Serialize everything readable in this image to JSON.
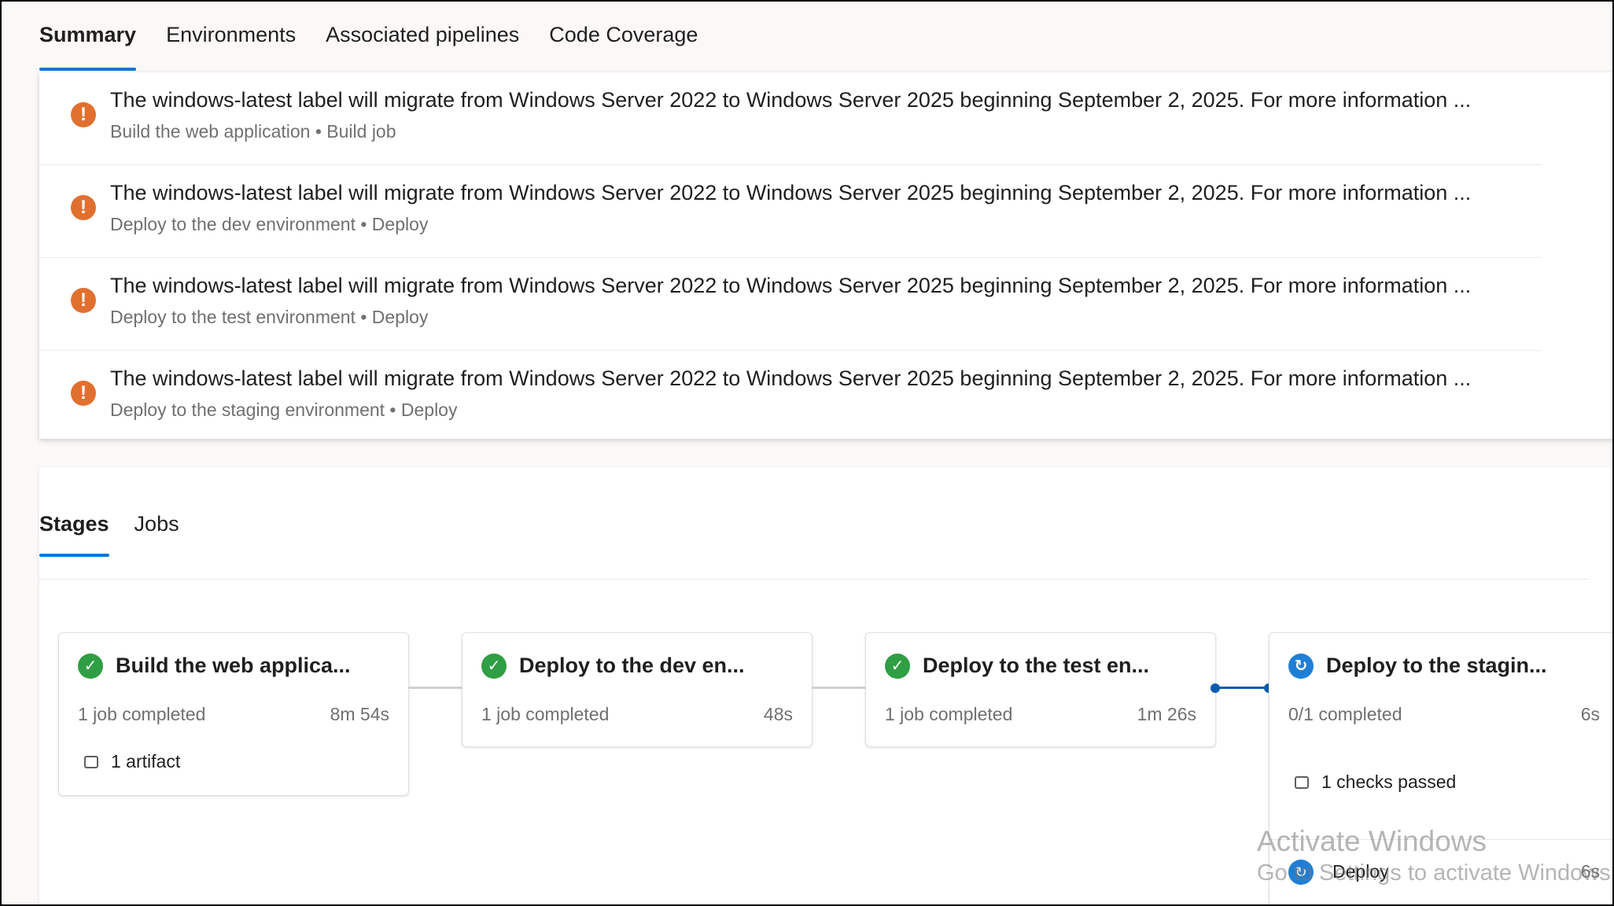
{
  "tabs": [
    {
      "label": "Summary",
      "active": true
    },
    {
      "label": "Environments",
      "active": false
    },
    {
      "label": "Associated pipelines",
      "active": false
    },
    {
      "label": "Code Coverage",
      "active": false
    }
  ],
  "issues": [
    {
      "message": "The windows-latest label will migrate from Windows Server 2022 to Windows Server 2025 beginning September 2, 2025. For more information ...",
      "source": "Build the web application • Build job"
    },
    {
      "message": "The windows-latest label will migrate from Windows Server 2022 to Windows Server 2025 beginning September 2, 2025. For more information ...",
      "source": "Deploy to the dev environment • Deploy"
    },
    {
      "message": "The windows-latest label will migrate from Windows Server 2022 to Windows Server 2025 beginning September 2, 2025. For more information ...",
      "source": "Deploy to the test environment • Deploy"
    },
    {
      "message": "The windows-latest label will migrate from Windows Server 2022 to Windows Server 2025 beginning September 2, 2025. For more information ...",
      "source": "Deploy to the staging environment • Deploy"
    }
  ],
  "subtabs": [
    {
      "label": "Stages",
      "active": true
    },
    {
      "label": "Jobs",
      "active": false
    }
  ],
  "stages": [
    {
      "title": "Build the web applica...",
      "status": "1 job completed",
      "duration": "8m 54s",
      "extra": "1 artifact",
      "state": "success"
    },
    {
      "title": "Deploy to the dev en...",
      "status": "1 job completed",
      "duration": "48s",
      "state": "success"
    },
    {
      "title": "Deploy to the test en...",
      "status": "1 job completed",
      "duration": "1m 26s",
      "state": "success"
    },
    {
      "title": "Deploy to the stagin...",
      "status": "0/1 completed",
      "duration": "6s",
      "extra": "1 checks passed",
      "state": "running",
      "job": {
        "name": "Deploy",
        "duration": "6s"
      }
    }
  ],
  "watermark": {
    "title": "Activate Windows",
    "subtitle": "Go to Settings to activate Windows."
  },
  "colors": {
    "accent": "#0078d4",
    "warning": "#e07030",
    "success": "#2f9e44",
    "running": "#1f7fd6"
  }
}
